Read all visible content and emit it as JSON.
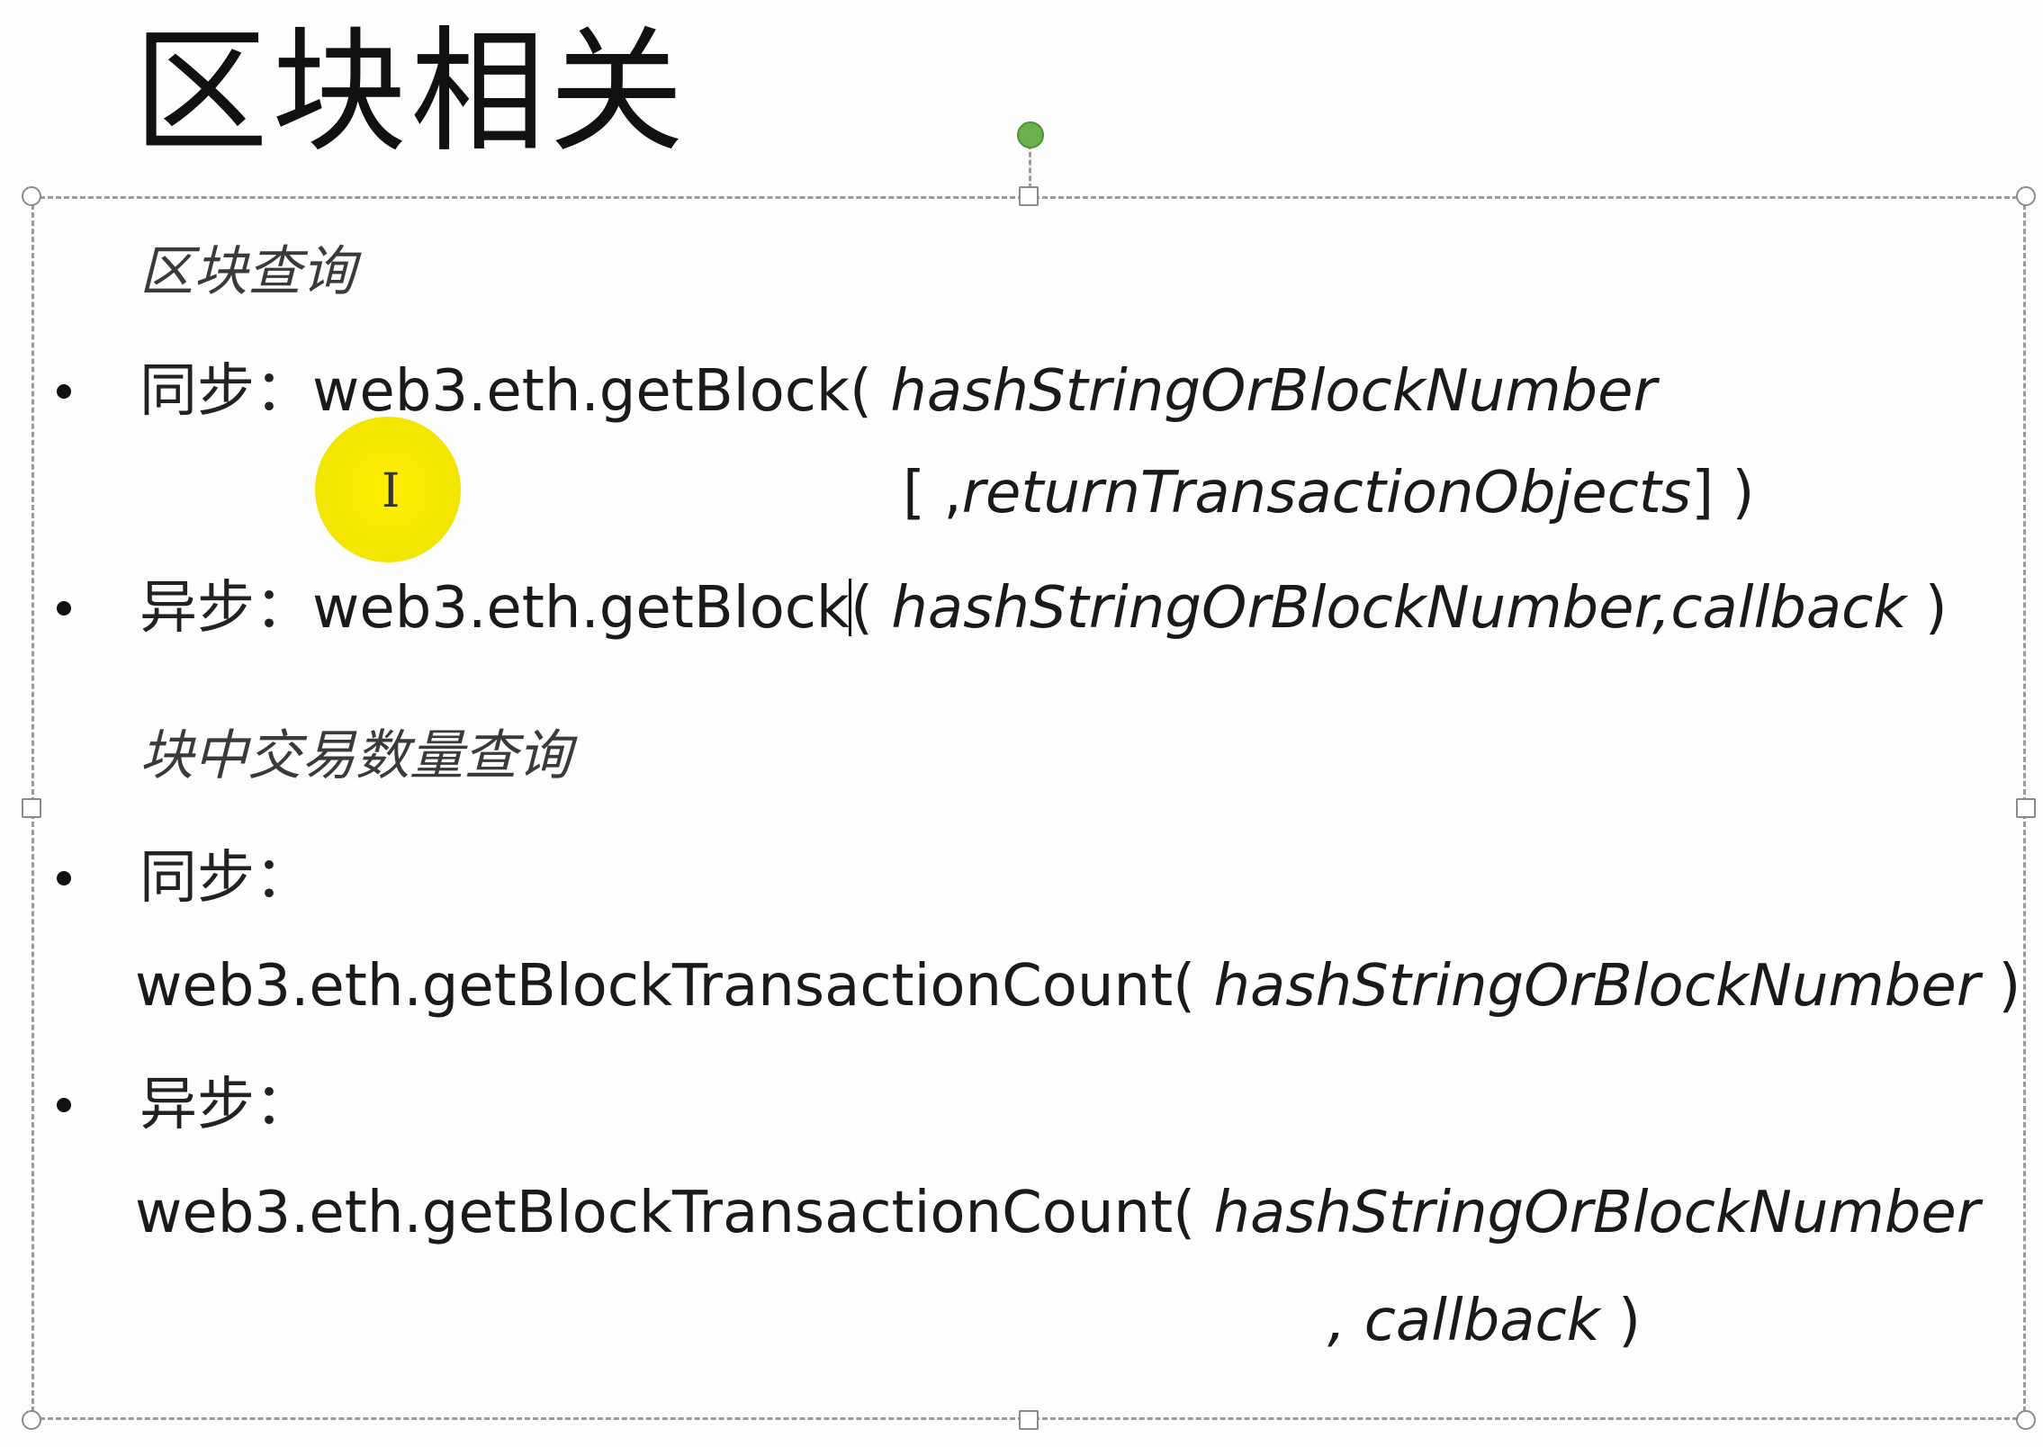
{
  "slide": {
    "title": "区块相关"
  },
  "section_block_query": {
    "heading": "区块查询",
    "sync": {
      "label": "同步：",
      "call": "web3.eth.getBlock(",
      "param1": "hashStringOrBlockNumber",
      "param2_prefix": "[ ,",
      "param2": "returnTransactionObjects",
      "param2_suffix": "] )"
    },
    "async": {
      "label": "异步：",
      "call_a": "web3.eth.getBlock",
      "call_b": "(",
      "param1": "hashStringOrBlockNumber",
      "sep": ",",
      "param2": "callback",
      "close": " )"
    }
  },
  "section_tx_count": {
    "heading": "块中交易数量查询",
    "sync": {
      "label": "同步：",
      "call": "web3.eth.getBlockTransactionCount( ",
      "param1": "hashStringOrBlockNumber",
      "close": " )"
    },
    "async": {
      "label": "异步：",
      "call": "web3.eth.getBlockTransactionCount( ",
      "param1": "hashStringOrBlockNumber",
      "sep": ", ",
      "param2": "callback",
      "close": " )"
    }
  },
  "cursor": {
    "icon": "text-ibeam-cursor-icon",
    "glyph": "I",
    "highlight_color": "#ffee00"
  },
  "colors": {
    "rotation_handle": "#6ab04c",
    "frame": "#9a9a9a"
  }
}
